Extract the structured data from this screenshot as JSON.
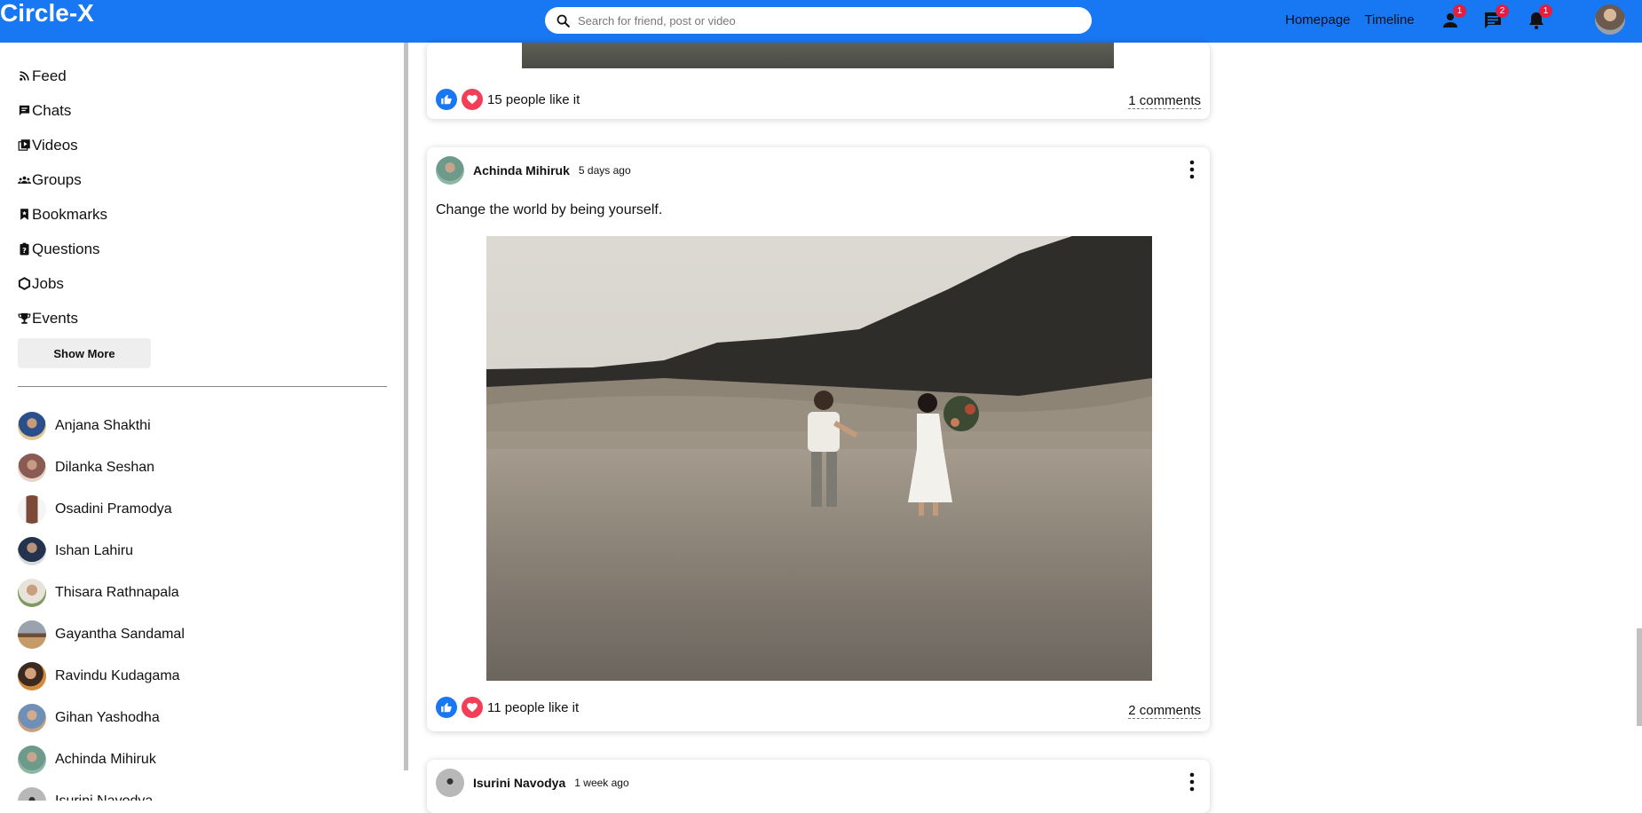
{
  "app": {
    "title": "Circle-X"
  },
  "search": {
    "placeholder": "Search for friend, post or video"
  },
  "topnav": {
    "links": [
      "Homepage",
      "Timeline"
    ],
    "badges": {
      "friends": "1",
      "messages": "2",
      "notifications": "1"
    }
  },
  "colors": {
    "brand": "#1877f2",
    "badge": "#e41e3f",
    "like": "#1877f2",
    "heart": "#f33e58"
  },
  "sidebar": {
    "menu": [
      {
        "label": "Feed",
        "icon": "rss-icon"
      },
      {
        "label": "Chats",
        "icon": "chat-icon"
      },
      {
        "label": "Videos",
        "icon": "video-library-icon"
      },
      {
        "label": "Groups",
        "icon": "group-icon"
      },
      {
        "label": "Bookmarks",
        "icon": "bookmark-icon"
      },
      {
        "label": "Questions",
        "icon": "help-clipboard-icon"
      },
      {
        "label": "Jobs",
        "icon": "work-outline-icon"
      },
      {
        "label": "Events",
        "icon": "trophy-icon"
      }
    ],
    "show_more_label": "Show More",
    "friends": [
      "Anjana Shakthi",
      "Dilanka Seshan",
      "Osadini Pramodya",
      "Ishan Lahiru",
      "Thisara Rathnapala",
      "Gayantha Sandamal",
      "Ravindu Kudagama",
      "Gihan Yashodha",
      "Achinda Mihiruk",
      "Isurini Navodya"
    ]
  },
  "posts": [
    {
      "likes_text": "15 people like it",
      "comments_text": "1 comments"
    },
    {
      "user": "Achinda Mihiruk",
      "time": "5 days ago",
      "text": "Change the world by being yourself.",
      "likes_text": "11 people like it",
      "comments_text": "2 comments"
    },
    {
      "user": "Isurini Navodya",
      "time": "1 week ago"
    }
  ]
}
